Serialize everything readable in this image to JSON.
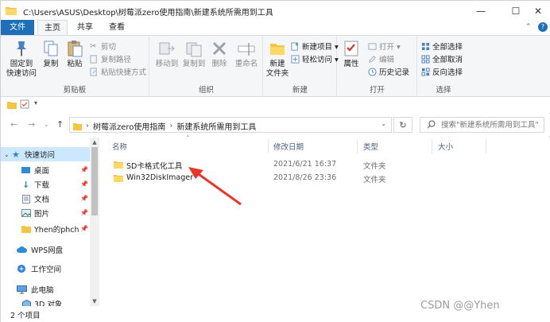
{
  "window": {
    "path": "C:\\Users\\ASUS\\Desktop\\树莓派zero使用指南\\新建系统所需用到工具"
  },
  "tabs": [
    "文件",
    "主页",
    "共享",
    "查看"
  ],
  "ribbon": {
    "clipboard": {
      "pin": "固定到\n快速访问",
      "copy": "复制",
      "paste": "粘贴",
      "cut": "剪切",
      "copy_path": "复制路径",
      "paste_shortcut": "粘贴快捷方式",
      "label": "剪贴板"
    },
    "organize": {
      "move_to": "移动到",
      "copy_to": "复制到",
      "delete": "删除",
      "rename": "重命名",
      "label": "组织"
    },
    "new": {
      "new_folder": "新建\n文件夹",
      "new_item": "新建项目 ▾",
      "easy_access": "轻松访问 ▾",
      "label": "新建"
    },
    "open": {
      "properties": "属性",
      "open": "打开 ▾",
      "edit": "编辑",
      "history": "历史记录",
      "label": "打开"
    },
    "select": {
      "select_all": "全部选择",
      "select_none": "全部取消",
      "invert": "反向选择",
      "label": "选择"
    }
  },
  "address": {
    "crumbs": [
      "树莓派zero使用指南",
      "新建系统所需用到工具"
    ],
    "search_placeholder": "搜索\"新建系统所需用到工具\""
  },
  "nav": {
    "items": [
      {
        "label": "快速访问",
        "pinned": false
      },
      {
        "label": "桌面",
        "pinned": true
      },
      {
        "label": "下载",
        "pinned": true
      },
      {
        "label": "文档",
        "pinned": true
      },
      {
        "label": "图片",
        "pinned": true
      },
      {
        "label": "Yhen的phch",
        "pinned": true
      },
      {
        "label": "WPS网盘",
        "pinned": false
      },
      {
        "label": "工作空间",
        "pinned": false
      },
      {
        "label": "此电脑",
        "pinned": false
      },
      {
        "label": "3D 对象",
        "pinned": false
      }
    ]
  },
  "columns": {
    "name": "名称",
    "date": "修改日期",
    "type": "类型",
    "size": "大小"
  },
  "files": [
    {
      "name": "SD卡格式化工具",
      "date": "2021/6/21 16:37",
      "type": "文件夹"
    },
    {
      "name": "Win32DiskImager",
      "date": "2021/8/26 23:36",
      "type": "文件夹"
    }
  ],
  "status": {
    "count": "2 个项目"
  },
  "watermark": "CSDN @@Yhen",
  "colors": {
    "accent": "#1e6fba",
    "selection": "#cce8ff",
    "folder": "#f5c542",
    "arrow": "#e8372a"
  }
}
